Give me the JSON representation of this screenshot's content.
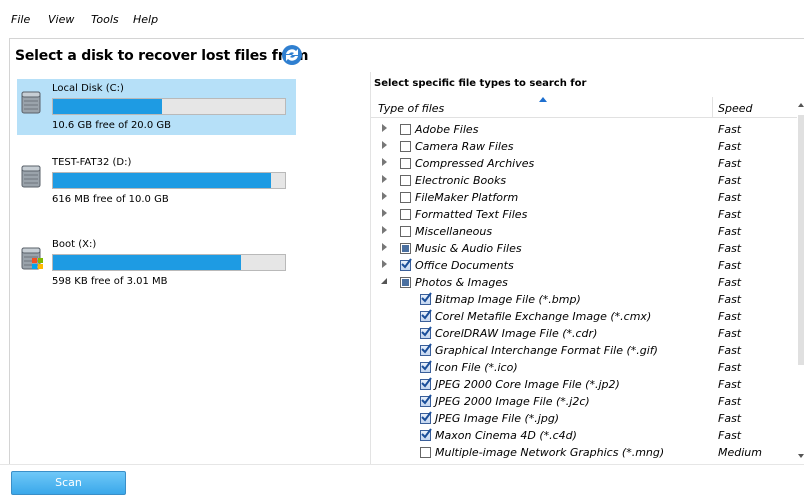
{
  "menu": {
    "file": "File",
    "view": "View",
    "tools": "Tools",
    "help": "Help"
  },
  "header": {
    "title": "Select a disk to recover lost files from",
    "refresh_icon": "refresh-icon"
  },
  "disks": [
    {
      "name": "Local Disk (C:)",
      "free": "10.6 GB free of 20.0 GB",
      "used_fraction": 0.47,
      "icon": "hard-drive-icon",
      "selected": true
    },
    {
      "name": "TEST-FAT32 (D:)",
      "free": "616 MB free of 10.0 GB",
      "used_fraction": 0.94,
      "icon": "hard-drive-icon",
      "selected": false
    },
    {
      "name": "Boot (X:)",
      "free": "598 KB free of 3.01 MB",
      "used_fraction": 0.81,
      "icon": "windows-drive-icon",
      "selected": false
    }
  ],
  "filetypes": {
    "title": "Select specific file types to search for",
    "columns": {
      "type": "Type of files",
      "speed": "Speed"
    },
    "rows": [
      {
        "label": "Adobe Files",
        "speed": "Fast",
        "level": 0,
        "expander": "collapsed",
        "check": "none"
      },
      {
        "label": "Camera Raw Files",
        "speed": "Fast",
        "level": 0,
        "expander": "collapsed",
        "check": "none"
      },
      {
        "label": "Compressed Archives",
        "speed": "Fast",
        "level": 0,
        "expander": "collapsed",
        "check": "none"
      },
      {
        "label": "Electronic Books",
        "speed": "Fast",
        "level": 0,
        "expander": "collapsed",
        "check": "none"
      },
      {
        "label": "FileMaker Platform",
        "speed": "Fast",
        "level": 0,
        "expander": "collapsed",
        "check": "none"
      },
      {
        "label": "Formatted Text Files",
        "speed": "Fast",
        "level": 0,
        "expander": "collapsed",
        "check": "none"
      },
      {
        "label": "Miscellaneous",
        "speed": "Fast",
        "level": 0,
        "expander": "collapsed",
        "check": "none"
      },
      {
        "label": "Music & Audio Files",
        "speed": "Fast",
        "level": 0,
        "expander": "collapsed",
        "check": "partial"
      },
      {
        "label": "Office Documents",
        "speed": "Fast",
        "level": 0,
        "expander": "collapsed",
        "check": "checked"
      },
      {
        "label": "Photos & Images",
        "speed": "Fast",
        "level": 0,
        "expander": "expanded",
        "check": "partial"
      },
      {
        "label": "Bitmap Image File (*.bmp)",
        "speed": "Fast",
        "level": 1,
        "expander": "none",
        "check": "checked"
      },
      {
        "label": "Corel Metafile Exchange Image (*.cmx)",
        "speed": "Fast",
        "level": 1,
        "expander": "none",
        "check": "checked"
      },
      {
        "label": "CorelDRAW Image File (*.cdr)",
        "speed": "Fast",
        "level": 1,
        "expander": "none",
        "check": "checked"
      },
      {
        "label": "Graphical Interchange Format File (*.gif)",
        "speed": "Fast",
        "level": 1,
        "expander": "none",
        "check": "checked"
      },
      {
        "label": "Icon File (*.ico)",
        "speed": "Fast",
        "level": 1,
        "expander": "none",
        "check": "checked"
      },
      {
        "label": "JPEG 2000 Core Image File (*.jp2)",
        "speed": "Fast",
        "level": 1,
        "expander": "none",
        "check": "checked"
      },
      {
        "label": "JPEG 2000 Image File (*.j2c)",
        "speed": "Fast",
        "level": 1,
        "expander": "none",
        "check": "checked"
      },
      {
        "label": "JPEG Image File (*.jpg)",
        "speed": "Fast",
        "level": 1,
        "expander": "none",
        "check": "checked"
      },
      {
        "label": "Maxon Cinema 4D (*.c4d)",
        "speed": "Fast",
        "level": 1,
        "expander": "none",
        "check": "checked"
      },
      {
        "label": "Multiple-image Network Graphics (*.mng)",
        "speed": "Medium",
        "level": 1,
        "expander": "none",
        "check": "none"
      }
    ]
  },
  "footer": {
    "scan_label": "Scan"
  },
  "colors": {
    "accent": "#1e9be3",
    "selection": "#b6e0f8",
    "button": "#3aa8ea"
  }
}
